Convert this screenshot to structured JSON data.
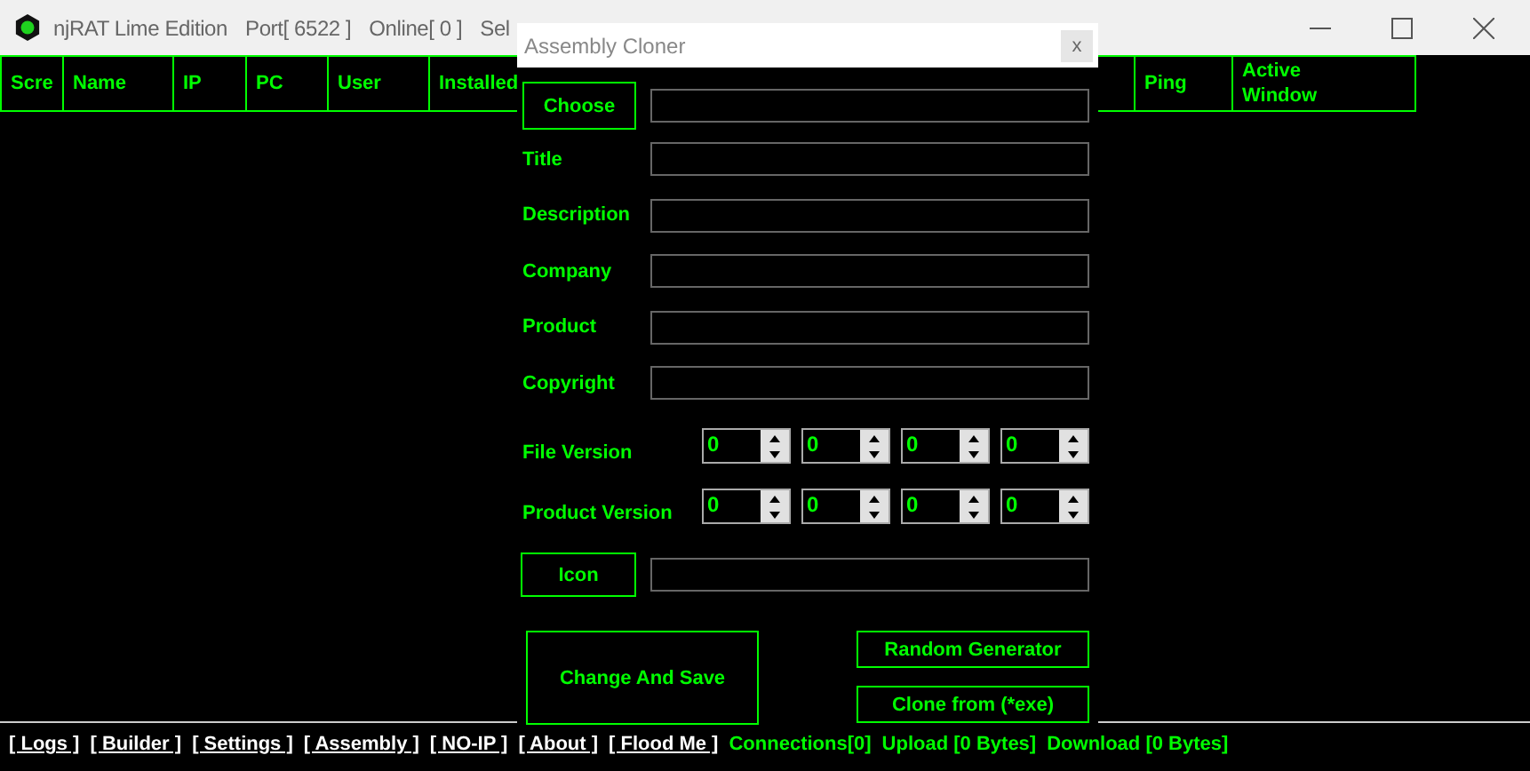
{
  "window": {
    "title": "njRAT Lime Edition",
    "port": "Port[ 6522 ]",
    "online": "Online[ 0 ]",
    "selected": "Sel"
  },
  "columns": [
    {
      "label": "Scre"
    },
    {
      "label": "Name"
    },
    {
      "label": "IP"
    },
    {
      "label": "PC"
    },
    {
      "label": "User"
    },
    {
      "label": "Installed"
    },
    {
      "label": "Ping"
    },
    {
      "label": "Active Window"
    }
  ],
  "dialog": {
    "title": "Assembly Cloner",
    "close": "x",
    "rows": [
      {
        "kind": "button",
        "label": "Choose"
      },
      {
        "kind": "text",
        "label": "Title"
      },
      {
        "kind": "text",
        "label": "Description"
      },
      {
        "kind": "text",
        "label": "Company"
      },
      {
        "kind": "text",
        "label": "Product"
      },
      {
        "kind": "text",
        "label": "Copyright"
      },
      {
        "kind": "version",
        "label": "File Version",
        "values": [
          "0",
          "0",
          "0",
          "0"
        ]
      },
      {
        "kind": "version",
        "label": "Product Version",
        "values": [
          "0",
          "0",
          "0",
          "0"
        ]
      },
      {
        "kind": "button",
        "label": "Icon"
      }
    ],
    "main_button": "Change And Save",
    "side_buttons": [
      "Random Generator",
      "Clone from (*exe)"
    ]
  },
  "status_links": [
    "[ Logs ]",
    "[ Builder ]",
    "[ Settings ]",
    "[ Assembly ]",
    "[ NO-IP ]",
    "[ About ]",
    "[ Flood Me ]"
  ],
  "status_texts": [
    "Connections[0]",
    "Upload [0 Bytes]",
    "Download [0 Bytes]"
  ]
}
